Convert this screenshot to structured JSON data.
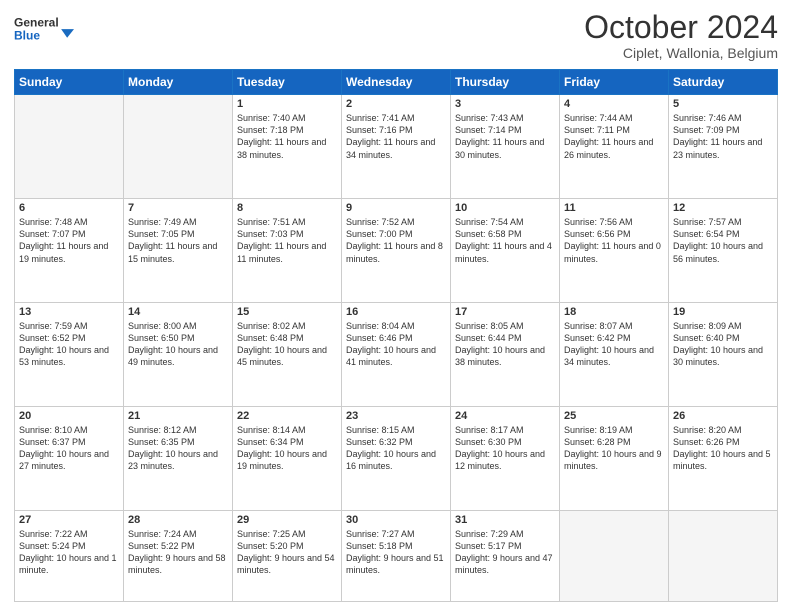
{
  "header": {
    "logo_general": "General",
    "logo_blue": "Blue",
    "month_title": "October 2024",
    "subtitle": "Ciplet, Wallonia, Belgium"
  },
  "days_of_week": [
    "Sunday",
    "Monday",
    "Tuesday",
    "Wednesday",
    "Thursday",
    "Friday",
    "Saturday"
  ],
  "weeks": [
    [
      {
        "day": "",
        "sunrise": "",
        "sunset": "",
        "daylight": ""
      },
      {
        "day": "",
        "sunrise": "",
        "sunset": "",
        "daylight": ""
      },
      {
        "day": "1",
        "sunrise": "Sunrise: 7:40 AM",
        "sunset": "Sunset: 7:18 PM",
        "daylight": "Daylight: 11 hours and 38 minutes."
      },
      {
        "day": "2",
        "sunrise": "Sunrise: 7:41 AM",
        "sunset": "Sunset: 7:16 PM",
        "daylight": "Daylight: 11 hours and 34 minutes."
      },
      {
        "day": "3",
        "sunrise": "Sunrise: 7:43 AM",
        "sunset": "Sunset: 7:14 PM",
        "daylight": "Daylight: 11 hours and 30 minutes."
      },
      {
        "day": "4",
        "sunrise": "Sunrise: 7:44 AM",
        "sunset": "Sunset: 7:11 PM",
        "daylight": "Daylight: 11 hours and 26 minutes."
      },
      {
        "day": "5",
        "sunrise": "Sunrise: 7:46 AM",
        "sunset": "Sunset: 7:09 PM",
        "daylight": "Daylight: 11 hours and 23 minutes."
      }
    ],
    [
      {
        "day": "6",
        "sunrise": "Sunrise: 7:48 AM",
        "sunset": "Sunset: 7:07 PM",
        "daylight": "Daylight: 11 hours and 19 minutes."
      },
      {
        "day": "7",
        "sunrise": "Sunrise: 7:49 AM",
        "sunset": "Sunset: 7:05 PM",
        "daylight": "Daylight: 11 hours and 15 minutes."
      },
      {
        "day": "8",
        "sunrise": "Sunrise: 7:51 AM",
        "sunset": "Sunset: 7:03 PM",
        "daylight": "Daylight: 11 hours and 11 minutes."
      },
      {
        "day": "9",
        "sunrise": "Sunrise: 7:52 AM",
        "sunset": "Sunset: 7:00 PM",
        "daylight": "Daylight: 11 hours and 8 minutes."
      },
      {
        "day": "10",
        "sunrise": "Sunrise: 7:54 AM",
        "sunset": "Sunset: 6:58 PM",
        "daylight": "Daylight: 11 hours and 4 minutes."
      },
      {
        "day": "11",
        "sunrise": "Sunrise: 7:56 AM",
        "sunset": "Sunset: 6:56 PM",
        "daylight": "Daylight: 11 hours and 0 minutes."
      },
      {
        "day": "12",
        "sunrise": "Sunrise: 7:57 AM",
        "sunset": "Sunset: 6:54 PM",
        "daylight": "Daylight: 10 hours and 56 minutes."
      }
    ],
    [
      {
        "day": "13",
        "sunrise": "Sunrise: 7:59 AM",
        "sunset": "Sunset: 6:52 PM",
        "daylight": "Daylight: 10 hours and 53 minutes."
      },
      {
        "day": "14",
        "sunrise": "Sunrise: 8:00 AM",
        "sunset": "Sunset: 6:50 PM",
        "daylight": "Daylight: 10 hours and 49 minutes."
      },
      {
        "day": "15",
        "sunrise": "Sunrise: 8:02 AM",
        "sunset": "Sunset: 6:48 PM",
        "daylight": "Daylight: 10 hours and 45 minutes."
      },
      {
        "day": "16",
        "sunrise": "Sunrise: 8:04 AM",
        "sunset": "Sunset: 6:46 PM",
        "daylight": "Daylight: 10 hours and 41 minutes."
      },
      {
        "day": "17",
        "sunrise": "Sunrise: 8:05 AM",
        "sunset": "Sunset: 6:44 PM",
        "daylight": "Daylight: 10 hours and 38 minutes."
      },
      {
        "day": "18",
        "sunrise": "Sunrise: 8:07 AM",
        "sunset": "Sunset: 6:42 PM",
        "daylight": "Daylight: 10 hours and 34 minutes."
      },
      {
        "day": "19",
        "sunrise": "Sunrise: 8:09 AM",
        "sunset": "Sunset: 6:40 PM",
        "daylight": "Daylight: 10 hours and 30 minutes."
      }
    ],
    [
      {
        "day": "20",
        "sunrise": "Sunrise: 8:10 AM",
        "sunset": "Sunset: 6:37 PM",
        "daylight": "Daylight: 10 hours and 27 minutes."
      },
      {
        "day": "21",
        "sunrise": "Sunrise: 8:12 AM",
        "sunset": "Sunset: 6:35 PM",
        "daylight": "Daylight: 10 hours and 23 minutes."
      },
      {
        "day": "22",
        "sunrise": "Sunrise: 8:14 AM",
        "sunset": "Sunset: 6:34 PM",
        "daylight": "Daylight: 10 hours and 19 minutes."
      },
      {
        "day": "23",
        "sunrise": "Sunrise: 8:15 AM",
        "sunset": "Sunset: 6:32 PM",
        "daylight": "Daylight: 10 hours and 16 minutes."
      },
      {
        "day": "24",
        "sunrise": "Sunrise: 8:17 AM",
        "sunset": "Sunset: 6:30 PM",
        "daylight": "Daylight: 10 hours and 12 minutes."
      },
      {
        "day": "25",
        "sunrise": "Sunrise: 8:19 AM",
        "sunset": "Sunset: 6:28 PM",
        "daylight": "Daylight: 10 hours and 9 minutes."
      },
      {
        "day": "26",
        "sunrise": "Sunrise: 8:20 AM",
        "sunset": "Sunset: 6:26 PM",
        "daylight": "Daylight: 10 hours and 5 minutes."
      }
    ],
    [
      {
        "day": "27",
        "sunrise": "Sunrise: 7:22 AM",
        "sunset": "Sunset: 5:24 PM",
        "daylight": "Daylight: 10 hours and 1 minute."
      },
      {
        "day": "28",
        "sunrise": "Sunrise: 7:24 AM",
        "sunset": "Sunset: 5:22 PM",
        "daylight": "Daylight: 9 hours and 58 minutes."
      },
      {
        "day": "29",
        "sunrise": "Sunrise: 7:25 AM",
        "sunset": "Sunset: 5:20 PM",
        "daylight": "Daylight: 9 hours and 54 minutes."
      },
      {
        "day": "30",
        "sunrise": "Sunrise: 7:27 AM",
        "sunset": "Sunset: 5:18 PM",
        "daylight": "Daylight: 9 hours and 51 minutes."
      },
      {
        "day": "31",
        "sunrise": "Sunrise: 7:29 AM",
        "sunset": "Sunset: 5:17 PM",
        "daylight": "Daylight: 9 hours and 47 minutes."
      },
      {
        "day": "",
        "sunrise": "",
        "sunset": "",
        "daylight": ""
      },
      {
        "day": "",
        "sunrise": "",
        "sunset": "",
        "daylight": ""
      }
    ]
  ]
}
